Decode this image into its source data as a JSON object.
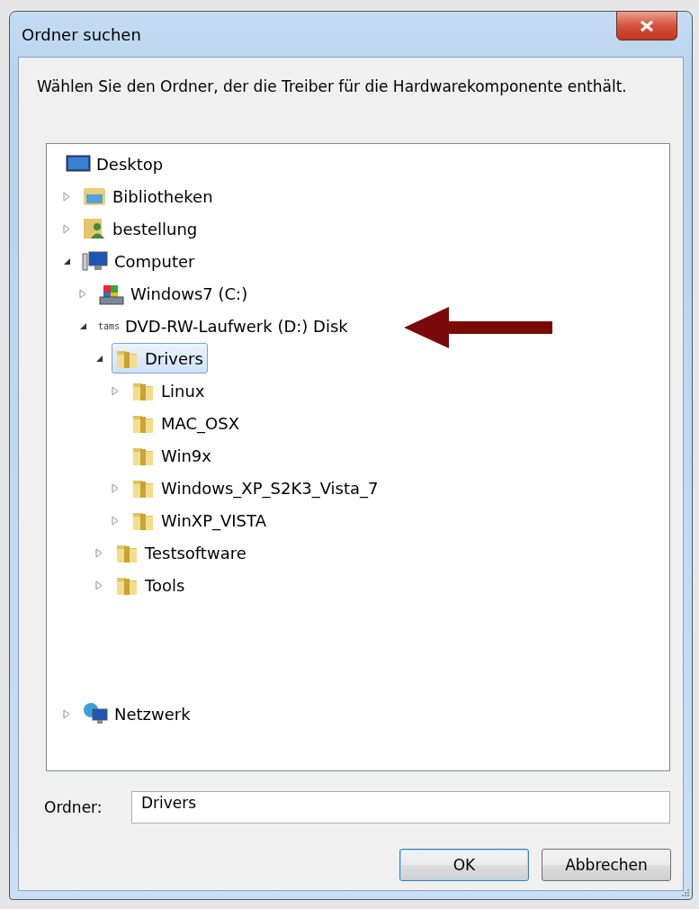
{
  "window": {
    "title": "Ordner suchen"
  },
  "instruction": "Wählen Sie den Ordner, der die Treiber für die Hardwarekomponente enthält.",
  "tree": [
    {
      "label": "Desktop",
      "kind": "desktop",
      "selected": false,
      "children": [
        {
          "label": "Bibliotheken",
          "kind": "library",
          "expandable": true,
          "expanded": false,
          "selected": false
        },
        {
          "label": "bestellung",
          "kind": "user",
          "expandable": true,
          "expanded": false,
          "selected": false
        },
        {
          "label": "Computer",
          "kind": "computer",
          "expandable": true,
          "expanded": true,
          "selected": false,
          "children": [
            {
              "label": "Windows7 (C:)",
              "kind": "drive",
              "expandable": true,
              "expanded": false,
              "selected": false
            },
            {
              "label": "DVD-RW-Laufwerk (D:) Disk",
              "kind": "disc",
              "icon_text": "tams",
              "expandable": true,
              "expanded": true,
              "selected": false,
              "children": [
                {
                  "label": "Drivers",
                  "kind": "folder",
                  "expandable": true,
                  "expanded": true,
                  "selected": true,
                  "children": [
                    {
                      "label": "Linux",
                      "kind": "folder",
                      "expandable": true,
                      "expanded": false,
                      "selected": false
                    },
                    {
                      "label": "MAC_OSX",
                      "kind": "folder",
                      "selected": false
                    },
                    {
                      "label": "Win9x",
                      "kind": "folder",
                      "selected": false
                    },
                    {
                      "label": "Windows_XP_S2K3_Vista_7",
                      "kind": "folder",
                      "expandable": true,
                      "expanded": false,
                      "selected": false
                    },
                    {
                      "label": "WinXP_VISTA",
                      "kind": "folder",
                      "expandable": true,
                      "expanded": false,
                      "selected": false
                    }
                  ]
                },
                {
                  "label": "Testsoftware",
                  "kind": "folder",
                  "expandable": true,
                  "expanded": false,
                  "selected": false
                },
                {
                  "label": "Tools",
                  "kind": "folder",
                  "expandable": true,
                  "expanded": false,
                  "selected": false
                }
              ]
            }
          ]
        },
        {
          "label": "Netzwerk",
          "kind": "network",
          "expandable": true,
          "expanded": false,
          "selected": false
        }
      ]
    }
  ],
  "folder_field": {
    "label": "Ordner:",
    "value": "Drivers"
  },
  "buttons": [
    {
      "label": "OK",
      "default": true
    },
    {
      "label": "Abbrechen",
      "default": false
    }
  ]
}
